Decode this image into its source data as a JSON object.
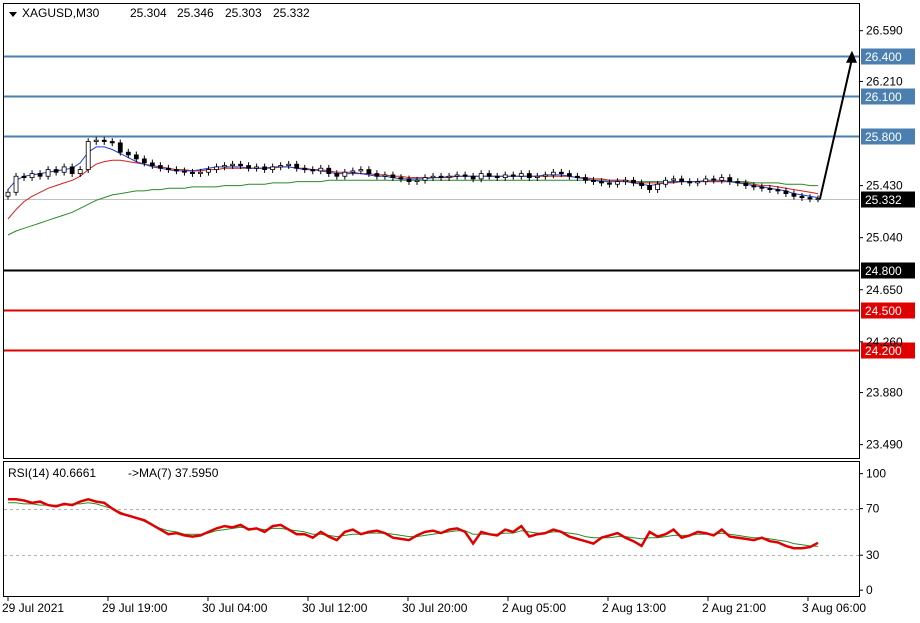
{
  "header": {
    "menu_icon": "triangle-down-icon",
    "symbol": "XAGUSD,M30",
    "open": "25.304",
    "high": "25.346",
    "low": "25.303",
    "close": "25.332"
  },
  "rsi_header": {
    "label": "RSI(14) 40.6661",
    "ma_label": "->MA(7) 37.5950"
  },
  "chart_data": {
    "type": "candlestick",
    "symbol": "XAGUSD",
    "timeframe": "M30",
    "price_axis": {
      "ylim": [
        23.39,
        26.79
      ],
      "ticks": [
        26.59,
        26.21,
        25.43,
        25.04,
        24.65,
        24.26,
        23.88,
        23.49
      ],
      "tick_labels": [
        "26.590",
        "26.210",
        "25.430",
        "25.040",
        "24.650",
        "24.260",
        "23.880",
        "23.490"
      ]
    },
    "x_axis": {
      "tick_labels": [
        "29 Jul 2021",
        "29 Jul 19:00",
        "30 Jul 04:00",
        "30 Jul 12:00",
        "30 Jul 20:00",
        "2 Aug 05:00",
        "2 Aug 13:00",
        "2 Aug 21:00",
        "3 Aug 06:00"
      ]
    },
    "levels": [
      {
        "value": 26.4,
        "label": "26.400",
        "color": "#4a7faf"
      },
      {
        "value": 26.1,
        "label": "26.100",
        "color": "#4a7faf"
      },
      {
        "value": 25.8,
        "label": "25.800",
        "color": "#4a7faf"
      },
      {
        "value": 24.8,
        "label": "24.800",
        "color": "#000000"
      },
      {
        "value": 24.5,
        "label": "24.500",
        "color": "#e00000"
      },
      {
        "value": 24.2,
        "label": "24.200",
        "color": "#e00000"
      }
    ],
    "current_price": {
      "value": 25.332,
      "label": "25.332",
      "color": "#000000"
    },
    "close_series": [
      25.38,
      25.5,
      25.49,
      25.52,
      25.5,
      25.55,
      25.53,
      25.57,
      25.52,
      25.55,
      25.76,
      25.77,
      25.76,
      25.75,
      25.68,
      25.66,
      25.63,
      25.6,
      25.58,
      25.56,
      25.55,
      25.54,
      25.53,
      25.52,
      25.53,
      25.55,
      25.57,
      25.58,
      25.59,
      25.58,
      25.56,
      25.57,
      25.55,
      25.57,
      25.58,
      25.59,
      25.56,
      25.55,
      25.54,
      25.56,
      25.52,
      25.5,
      25.53,
      25.54,
      25.55,
      25.52,
      25.5,
      25.51,
      25.49,
      25.48,
      25.46,
      25.47,
      25.49,
      25.5,
      25.49,
      25.5,
      25.51,
      25.5,
      25.48,
      25.52,
      25.5,
      25.49,
      25.51,
      25.5,
      25.52,
      25.49,
      25.5,
      25.51,
      25.53,
      25.52,
      25.5,
      25.49,
      25.47,
      25.46,
      25.45,
      25.44,
      25.46,
      25.47,
      25.45,
      25.43,
      25.4,
      25.44,
      25.47,
      25.48,
      25.46,
      25.45,
      25.46,
      25.48,
      25.47,
      25.49,
      25.46,
      25.45,
      25.43,
      25.42,
      25.41,
      25.4,
      25.39,
      25.37,
      25.35,
      25.34,
      25.33,
      25.332
    ],
    "ma_fast": [
      25.4,
      25.47,
      25.5,
      25.51,
      25.52,
      25.53,
      25.54,
      25.55,
      25.56,
      25.6,
      25.68,
      25.72,
      25.72,
      25.7,
      25.67,
      25.64,
      25.61,
      25.59,
      25.57,
      25.56,
      25.55,
      25.54,
      25.54,
      25.54,
      25.55,
      25.56,
      25.57,
      25.57,
      25.57,
      25.57,
      25.56,
      25.56,
      25.56,
      25.57,
      25.57,
      25.57,
      25.56,
      25.55,
      25.55,
      25.54,
      25.53,
      25.52,
      25.52,
      25.52,
      25.52,
      25.51,
      25.5,
      25.5,
      25.49,
      25.48,
      25.48,
      25.48,
      25.48,
      25.49,
      25.49,
      25.5,
      25.5,
      25.5,
      25.5,
      25.5,
      25.5,
      25.5,
      25.5,
      25.5,
      25.5,
      25.5,
      25.5,
      25.51,
      25.51,
      25.51,
      25.5,
      25.49,
      25.48,
      25.47,
      25.46,
      25.46,
      25.46,
      25.46,
      25.45,
      25.44,
      25.43,
      25.44,
      25.45,
      25.46,
      25.46,
      25.46,
      25.46,
      25.47,
      25.47,
      25.47,
      25.46,
      25.45,
      25.44,
      25.43,
      25.42,
      25.41,
      25.4,
      25.39,
      25.37,
      25.36,
      25.35,
      25.34
    ],
    "ma_mid": [
      25.18,
      25.25,
      25.31,
      25.35,
      25.38,
      25.41,
      25.43,
      25.45,
      25.47,
      25.5,
      25.55,
      25.59,
      25.61,
      25.62,
      25.62,
      25.61,
      25.6,
      25.59,
      25.58,
      25.57,
      25.56,
      25.55,
      25.55,
      25.54,
      25.54,
      25.55,
      25.55,
      25.56,
      25.56,
      25.56,
      25.56,
      25.56,
      25.56,
      25.56,
      25.57,
      25.57,
      25.56,
      25.56,
      25.55,
      25.55,
      25.54,
      25.53,
      25.53,
      25.53,
      25.52,
      25.52,
      25.51,
      25.51,
      25.5,
      25.5,
      25.49,
      25.49,
      25.49,
      25.49,
      25.49,
      25.49,
      25.5,
      25.5,
      25.5,
      25.5,
      25.5,
      25.5,
      25.5,
      25.5,
      25.5,
      25.5,
      25.5,
      25.5,
      25.5,
      25.5,
      25.5,
      25.49,
      25.49,
      25.48,
      25.48,
      25.47,
      25.47,
      25.47,
      25.46,
      25.45,
      25.45,
      25.45,
      25.45,
      25.45,
      25.46,
      25.46,
      25.46,
      25.46,
      25.46,
      25.46,
      25.46,
      25.45,
      25.45,
      25.44,
      25.43,
      25.43,
      25.42,
      25.41,
      25.4,
      25.39,
      25.38,
      25.37
    ],
    "ma_slow": [
      25.06,
      25.09,
      25.11,
      25.13,
      25.15,
      25.17,
      25.19,
      25.21,
      25.23,
      25.26,
      25.29,
      25.32,
      25.34,
      25.36,
      25.37,
      25.38,
      25.39,
      25.39,
      25.4,
      25.4,
      25.41,
      25.41,
      25.41,
      25.42,
      25.42,
      25.42,
      25.42,
      25.43,
      25.43,
      25.43,
      25.44,
      25.44,
      25.44,
      25.45,
      25.45,
      25.45,
      25.46,
      25.46,
      25.46,
      25.46,
      25.47,
      25.47,
      25.47,
      25.47,
      25.47,
      25.47,
      25.47,
      25.47,
      25.47,
      25.47,
      25.47,
      25.47,
      25.47,
      25.47,
      25.47,
      25.47,
      25.47,
      25.47,
      25.47,
      25.47,
      25.47,
      25.47,
      25.47,
      25.47,
      25.47,
      25.47,
      25.47,
      25.47,
      25.47,
      25.47,
      25.47,
      25.47,
      25.47,
      25.47,
      25.47,
      25.47,
      25.47,
      25.47,
      25.46,
      25.46,
      25.46,
      25.46,
      25.46,
      25.46,
      25.46,
      25.46,
      25.46,
      25.46,
      25.46,
      25.46,
      25.46,
      25.46,
      25.46,
      25.45,
      25.45,
      25.45,
      25.45,
      25.44,
      25.44,
      25.44,
      25.43,
      25.43
    ],
    "rsi": {
      "ylim": [
        -5,
        110
      ],
      "ticks": [
        100,
        70,
        30,
        0
      ],
      "tick_labels": [
        "100",
        "70",
        "30",
        "0"
      ],
      "levels_dashed": [
        70,
        30
      ],
      "values": [
        78,
        78,
        77,
        75,
        76,
        73,
        72,
        74,
        73,
        76,
        78,
        76,
        75,
        70,
        66,
        64,
        62,
        60,
        56,
        52,
        48,
        49,
        47,
        46,
        47,
        50,
        53,
        55,
        54,
        56,
        52,
        53,
        50,
        55,
        56,
        52,
        48,
        48,
        45,
        50,
        46,
        43,
        50,
        52,
        48,
        50,
        51,
        49,
        45,
        44,
        43,
        47,
        50,
        51,
        49,
        52,
        53,
        50,
        40,
        50,
        48,
        47,
        52,
        50,
        55,
        46,
        48,
        49,
        52,
        50,
        46,
        44,
        42,
        40,
        45,
        47,
        49,
        45,
        42,
        38,
        50,
        46,
        48,
        52,
        45,
        47,
        50,
        49,
        47,
        52,
        46,
        45,
        44,
        43,
        45,
        42,
        41,
        38,
        36,
        36,
        37,
        40.67
      ],
      "ma": [
        75,
        75,
        74,
        74,
        73,
        73,
        73,
        73,
        74,
        74,
        75,
        74,
        72,
        70,
        67,
        64,
        62,
        59,
        56,
        53,
        51,
        50,
        48,
        48,
        48,
        49,
        51,
        52,
        53,
        54,
        53,
        53,
        52,
        53,
        53,
        52,
        51,
        50,
        48,
        48,
        47,
        46,
        47,
        48,
        48,
        49,
        49,
        49,
        48,
        47,
        46,
        46,
        47,
        48,
        49,
        50,
        51,
        51,
        48,
        48,
        48,
        48,
        49,
        49,
        51,
        50,
        49,
        49,
        50,
        50,
        49,
        48,
        46,
        45,
        45,
        45,
        46,
        46,
        45,
        44,
        45,
        45,
        46,
        47,
        47,
        47,
        48,
        48,
        48,
        49,
        48,
        47,
        46,
        45,
        45,
        44,
        43,
        42,
        40,
        39,
        38,
        37.6
      ]
    },
    "colors": {
      "bull_candle": "#ffffff",
      "bear_candle": "#000000",
      "ma_fast": "#1f3fd6",
      "ma_mid": "#d62020",
      "ma_slow": "#2a8a2a",
      "rsi_line": "#e00000",
      "rsi_ma": "#2a8a2a",
      "arrow": "#000000"
    }
  }
}
